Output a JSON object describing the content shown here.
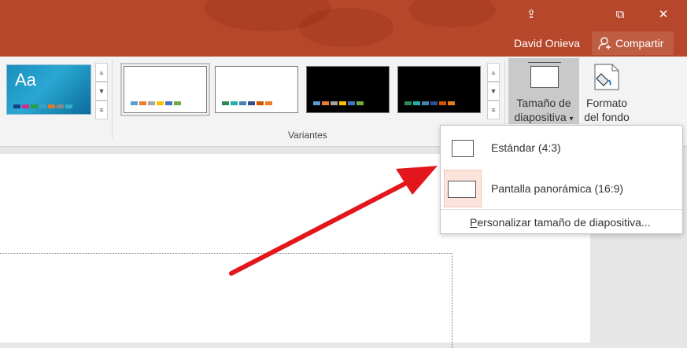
{
  "window": {
    "user_name": "David Onieva",
    "share_label": "Compartir",
    "controls": [
      "⇪",
      "⧉",
      "✕"
    ]
  },
  "ribbon": {
    "theme_preview_text": "Aa",
    "variants_group_label": "Variantes",
    "slide_size_button": {
      "line1": "Tamaño de",
      "line2": "diapositiva",
      "caret": "▾"
    },
    "format_background_button": {
      "line1": "Formato",
      "line2": "del fondo"
    }
  },
  "slide_size_menu": {
    "items": [
      {
        "label": "Estándar (4:3)",
        "highlighted": false
      },
      {
        "label": "Pantalla panorámica (16:9)",
        "highlighted": true
      }
    ],
    "custom_label": "Personalizar tamaño de diapositiva...",
    "custom_mnemonic": "P"
  },
  "colors": {
    "titlebar": "#b7472a",
    "highlight": "#fce4dc",
    "arrow": "#e2161c"
  }
}
